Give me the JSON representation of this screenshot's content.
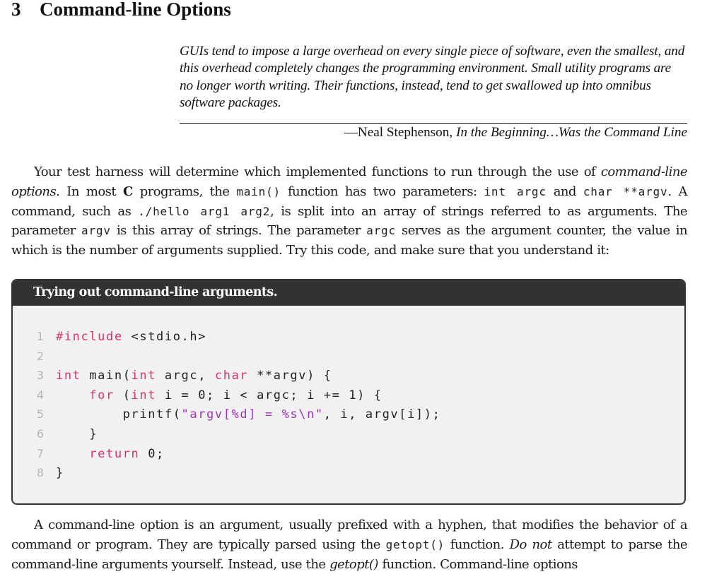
{
  "section": {
    "number": "3",
    "title": "Command-line Options"
  },
  "epigraph": {
    "quote": "GUIs tend to impose a large overhead on every single piece of software, even the smallest, and this overhead completely changes the programming environment. Small utility programs are no longer worth writing. Their functions, instead, tend to get swallowed up into omnibus software packages.",
    "dash_author": "—Neal Stephenson, ",
    "work_title": "In the Beginning…Was the Command Line"
  },
  "paragraph1": {
    "t1": "Your test harness will determine which implemented functions to run through the use of ",
    "em1": "command-line options",
    "t2": ". In most ",
    "bold1": "C",
    "t3": " programs, the ",
    "code1": "main()",
    "t4": " function has two parameters: ",
    "code2": "int argc",
    "t5": " and ",
    "code3": "char **argv",
    "t6": ". A command, such as ",
    "code4": "./hello arg1 arg2",
    "t7": ", is split into an array of strings referred to as arguments. The parameter ",
    "code5": "argv",
    "t8": " is this array of strings. The parameter ",
    "code6": "argc",
    "t9": " serves as the argument counter, the value in which is the number of arguments supplied. Try this code, and make sure that you understand it:"
  },
  "code_box": {
    "title": "Trying out command-line arguments.",
    "colors": {
      "keyword": "#d6336c",
      "string": "#a035b8",
      "line_number": "#b5b5b5",
      "header_bg": "#323232",
      "body_bg": "#f1f1f1"
    },
    "lines": [
      {
        "n": "1",
        "pp": "#include",
        "rest": " <stdio.h>"
      },
      {
        "n": "2"
      },
      {
        "n": "3",
        "kw1": "int",
        "a": " main(",
        "kw2": "int",
        "b": " argc, ",
        "kw3": "char",
        "c": " **argv) {"
      },
      {
        "n": "4",
        "indent": "    ",
        "kw1": "for",
        "a": " (",
        "kw2": "int",
        "b": " i = 0; i < argc; i += 1) {"
      },
      {
        "n": "5",
        "indent": "        ",
        "a": "printf(",
        "str": "\"argv[%d] = %s\\n\"",
        "b": ", i, argv[i]);"
      },
      {
        "n": "6",
        "indent": "    ",
        "a": "}"
      },
      {
        "n": "7",
        "indent": "    ",
        "kw1": "return",
        "a": " 0;"
      },
      {
        "n": "8",
        "a": "}"
      }
    ]
  },
  "paragraph2": {
    "t1": "A command-line option is an argument, usually prefixed with a hyphen, that modifies the behavior of a command or program. They are typically parsed using the ",
    "code1": "getopt()",
    "t2": " function. ",
    "em1": "Do not",
    "t3": " attempt to parse the command-line arguments yourself. Instead, use the ",
    "em2": "getopt()",
    "t4": " function. Command-line options"
  }
}
